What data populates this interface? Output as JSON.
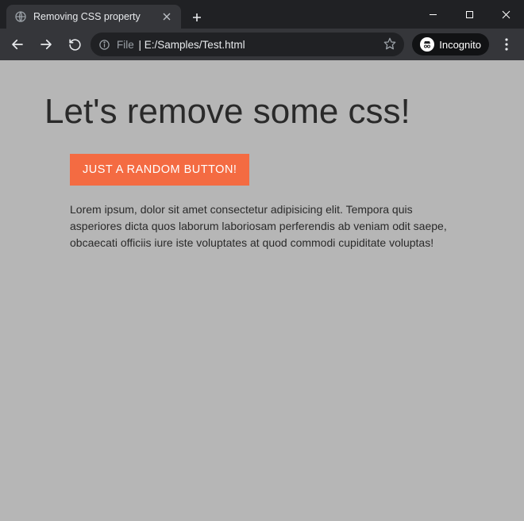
{
  "browser": {
    "tab_title": "Removing CSS property",
    "url_prefix": "File",
    "url_separator": " | ",
    "url_path": "E:/Samples/Test.html",
    "incognito_label": "Incognito"
  },
  "page": {
    "heading": "Let's remove some css!",
    "button_label": "JUST A RANDOM BUTTON!",
    "paragraph": "Lorem ipsum, dolor sit amet consectetur adipisicing elit. Tempora quis asperiores dicta quos laborum laboriosam perferendis ab veniam odit saepe, obcaecati officiis iure iste voluptates at quod commodi cupiditate voluptas!"
  }
}
